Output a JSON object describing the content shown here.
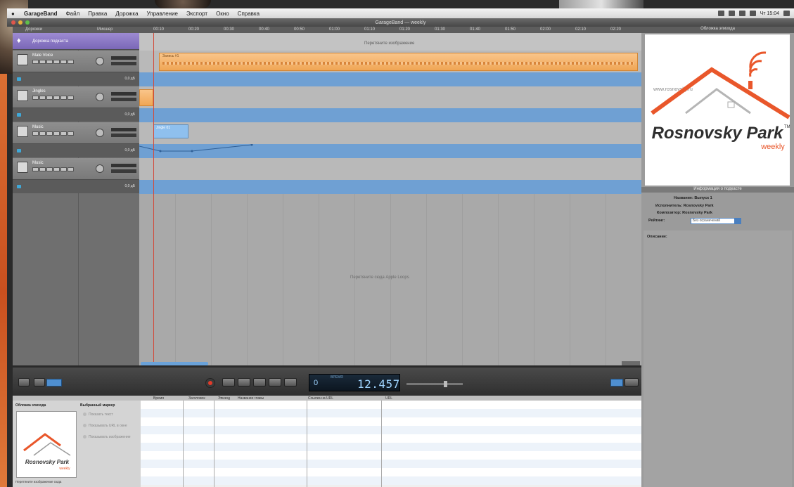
{
  "menubar": {
    "apple": "●",
    "app": "GarageBand",
    "items": [
      "Файл",
      "Правка",
      "Дорожка",
      "Управление",
      "Экспорт",
      "Окно",
      "Справка"
    ],
    "clock": "Чт 15:04"
  },
  "window": {
    "title": "GarageBand — weekly"
  },
  "header": {
    "col1": "Дорожки",
    "col2": "Микшер"
  },
  "ruler": [
    "00:10",
    "00:20",
    "00:30",
    "00:40",
    "00:50",
    "01:00",
    "01:10",
    "01:20",
    "01:30",
    "01:40",
    "01:50",
    "02:00",
    "02:10",
    "02:20"
  ],
  "tracks": [
    {
      "name": "Дорожка подкаста",
      "master": true
    },
    {
      "name": "Male Voice",
      "volume": "0,0 дБ"
    },
    {
      "name": "Jingles",
      "volume": "0,0 дБ"
    },
    {
      "name": "Music",
      "volume": "0,0 дБ"
    },
    {
      "name": "Music",
      "volume": "0,0 дБ"
    }
  ],
  "arrange": {
    "master_lane_text": "Перетяните изображение",
    "region_orange_label": "Запись #1",
    "region_blue_label": "Jingle 01",
    "empty_hint": "Перетяните сюда Apple Loops"
  },
  "transport": {
    "lcd_small": "0",
    "lcd_time": "12.457",
    "lcd_tiny": "ВРЕМЯ"
  },
  "bottom_editor": {
    "columns": [
      "Время",
      "Заголовок",
      "Эпизод",
      "Название главы",
      "Ссылка на URL",
      "URL"
    ],
    "panel_title_left": "Обложка эпизода",
    "panel_title_right": "Выбранный маркер",
    "options": [
      "Показать текст",
      "Показывать URL в окне",
      "Показывать изображение"
    ],
    "caption": "Перетяните изображение сюда"
  },
  "right_panel": {
    "header": "Обложка эпизода",
    "info_header": "Информация о подкасте",
    "info": [
      "Название: Выпуск 1",
      "Исполнитель: Rosnovsky Park",
      "Композитор: Rosnovsky Park",
      "Рейтинг: Без ограничений"
    ],
    "notes_label": "Описание:",
    "logo": {
      "url": "www.rosnovsky.ru",
      "name": "Rosnovsky Park",
      "tm": "TM",
      "sub": "weekly"
    }
  },
  "colors": {
    "accent_orange": "#e9572b",
    "region_orange": "#f0a655",
    "lane_blue": "#6fa0d3",
    "master_purple": "#7a67b7",
    "lcd_text": "#9fd4ff"
  }
}
